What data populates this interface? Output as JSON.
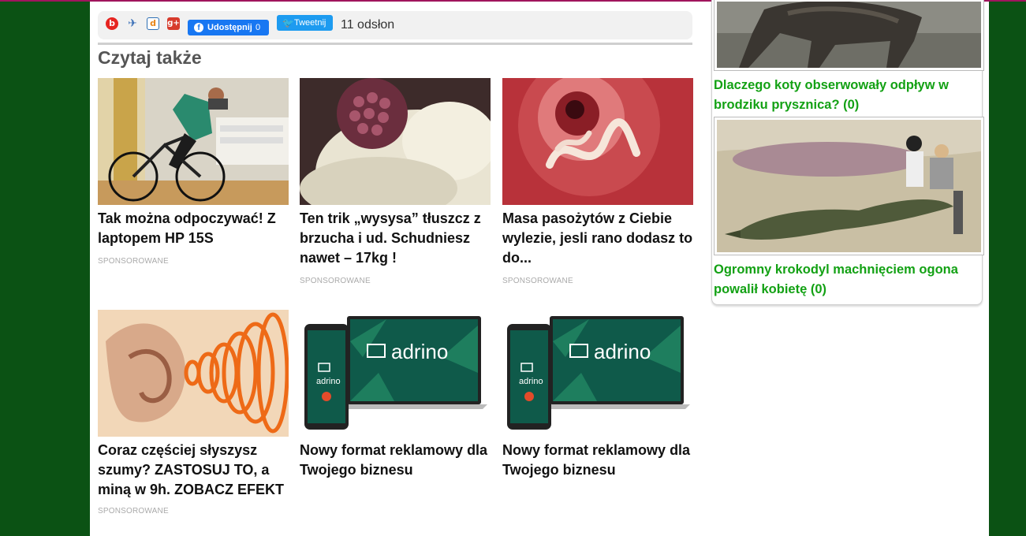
{
  "share": {
    "fb_label": "Udostępnij",
    "fb_count": "0",
    "tw_label": "Tweetnij",
    "views": "11 odsłon"
  },
  "section_title": "Czytaj także",
  "cards": [
    {
      "title": "Tak można odpoczywać! Z laptopem HP 15S",
      "sponsored": "SPONSOROWANE"
    },
    {
      "title": "Ten trik „wysysa” tłuszcz z brzucha i ud. Schudniesz nawet – 17kg !",
      "sponsored": "SPONSOROWANE"
    },
    {
      "title": "Masa pasożytów z Ciebie wylezie, jesli rano dodasz to do...",
      "sponsored": "SPONSOROWANE"
    },
    {
      "title": "Coraz częściej słyszysz szumy? ZASTOSUJ TO, a miną w 9h. ZOBACZ EFEKT",
      "sponsored": "SPONSOROWANE"
    },
    {
      "title": "Nowy format reklamowy dla Twojego biznesu",
      "logo_text": "adrino",
      "phone_logo_text": "adrino"
    },
    {
      "title": "Nowy format reklamowy dla Twojego biznesu",
      "logo_text": "adrino",
      "phone_logo_text": "adrino"
    }
  ],
  "sidebar": {
    "items": [
      {
        "link": "Dlaczego koty obserwowały odpływ w brodziku prysznica? (0)"
      },
      {
        "link": "Ogromny krokodyl machnięciem ogona powalił kobietę (0)"
      }
    ]
  },
  "colors": {
    "background": "#0b5214",
    "top_line": "#a0155d",
    "sidebar_link": "#13a114",
    "facebook": "#1877f2",
    "twitter": "#1d9bf0"
  },
  "icons": [
    "blip-icon",
    "wykop-icon",
    "digg-icon",
    "google-plus-icon",
    "facebook-icon",
    "twitter-icon"
  ]
}
